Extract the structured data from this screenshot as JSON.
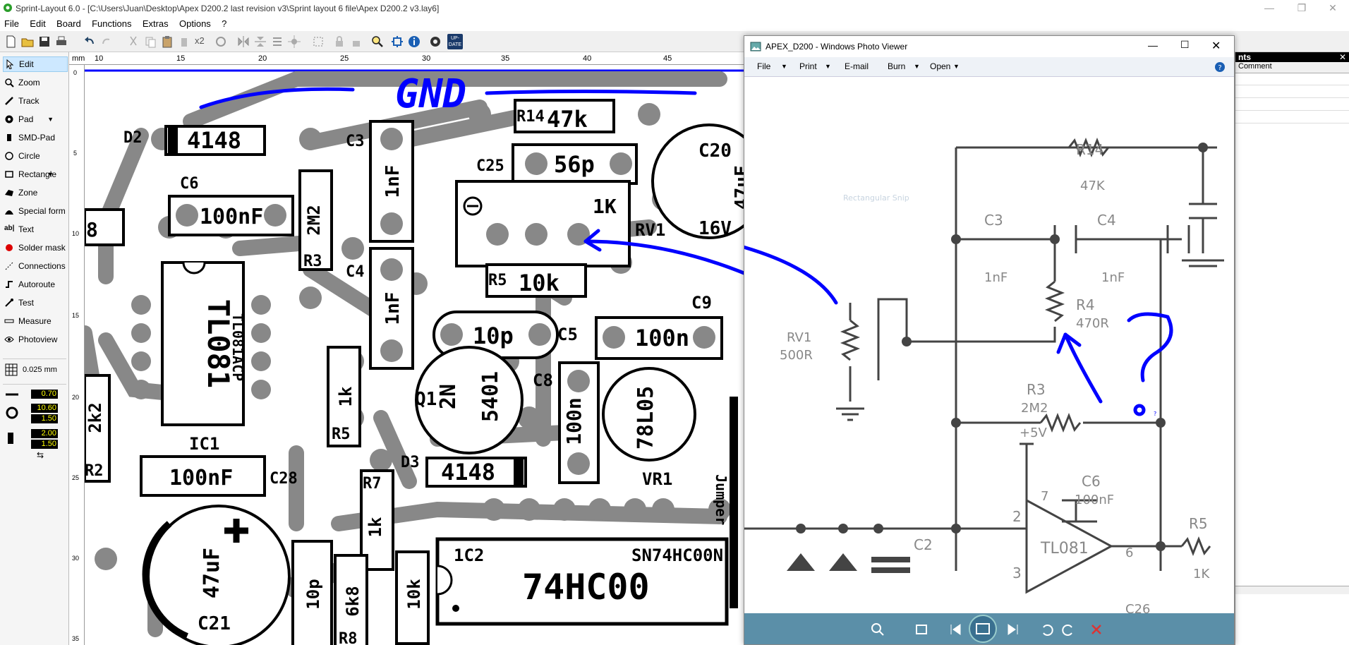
{
  "app": {
    "title": "Sprint-Layout 6.0 - [C:\\Users\\Juan\\Desktop\\Apex D200.2 last revision v3\\Sprint layout 6 file\\Apex D200.2 v3.lay6]",
    "accent": "#0000ff"
  },
  "menu": [
    "File",
    "Edit",
    "Board",
    "Functions",
    "Extras",
    "Options",
    "?"
  ],
  "toolbar": {
    "mult": "x2",
    "update": "UP-DATE"
  },
  "sidebar": {
    "tools": [
      {
        "label": "Edit",
        "icon": "cursor-icon"
      },
      {
        "label": "Zoom",
        "icon": "zoom-icon"
      },
      {
        "label": "Track",
        "icon": "track-icon"
      },
      {
        "label": "Pad",
        "icon": "pad-icon"
      },
      {
        "label": "SMD-Pad",
        "icon": "smd-pad-icon"
      },
      {
        "label": "Circle",
        "icon": "circle-icon"
      },
      {
        "label": "Rectangle",
        "icon": "rectangle-icon"
      },
      {
        "label": "Zone",
        "icon": "zone-icon"
      },
      {
        "label": "Special form",
        "icon": "special-form-icon"
      },
      {
        "label": "Text",
        "icon": "text-icon"
      },
      {
        "label": "Solder mask",
        "icon": "solder-mask-icon"
      },
      {
        "label": "Connections",
        "icon": "connections-icon"
      },
      {
        "label": "Autoroute",
        "icon": "autoroute-icon"
      },
      {
        "label": "Test",
        "icon": "test-icon"
      },
      {
        "label": "Measure",
        "icon": "measure-icon"
      },
      {
        "label": "Photoview",
        "icon": "photoview-icon"
      }
    ],
    "grid": "0.025 mm",
    "track_width": "0.70",
    "pad_outer": "10.60",
    "pad_inner": "1.50",
    "smd_w": "2.00",
    "smd_h": "1.50"
  },
  "ruler": {
    "unit": "mm",
    "top_ticks": [
      "10",
      "15",
      "20",
      "25",
      "30",
      "35",
      "40",
      "45"
    ],
    "left_ticks": [
      "0",
      "5",
      "10",
      "15",
      "20",
      "25",
      "30",
      "35"
    ]
  },
  "pcb": {
    "gnd": "GND",
    "labels": {
      "d2": "D2",
      "d2v": "4148",
      "c3": "C3",
      "c3v": "1nF",
      "r14": "R14",
      "r14v": "47k",
      "c20": "C20",
      "c20v": "47uF",
      "c20v2": "16V",
      "c25": "C25",
      "c25v": "56p",
      "c6": "C6",
      "c6v": "100nF",
      "r3v": "2M2",
      "r3": "R3",
      "rv1v": "1K",
      "rv1": "RV1",
      "c4": "C4",
      "c4v": "1nF",
      "r5": "R5",
      "r5v": "10k",
      "ic1v": "TL081",
      "ic1p": "TL081ACP",
      "ic1": "IC1",
      "c5v": "10p",
      "c5": "C5",
      "c9": "C9",
      "c9v": "100n",
      "q1": "Q1",
      "q1v": "2N",
      "q1v2": "5401",
      "c8": "C8",
      "c8v": "100n",
      "vr1v": "78L05",
      "vr1": "VR1",
      "r5b": "R5",
      "r5bv": "1k",
      "d3": "D3",
      "d3v": "4148",
      "c28v": "100nF",
      "c28": "C28",
      "r7": "R7",
      "r7v": "1k",
      "jumper": "Jumper",
      "ic2": "1C2",
      "ic2p": "SN74HC00N",
      "ic2v": "74HC00",
      "c21v": "47uF",
      "c21": "C21",
      "r2": "R2",
      "r2v": "2k2",
      "a8": "8",
      "b10p": "10p",
      "b6k8": "6k8",
      "r8": "R8",
      "b10k": "10k"
    }
  },
  "photo_viewer": {
    "title": "APEX_D200 - Windows Photo Viewer",
    "menu": [
      "File",
      "Print",
      "E-mail",
      "Burn",
      "Open"
    ],
    "schem": {
      "r14": "R14",
      "r14v": "47K",
      "c3": "C3",
      "c3v": "1nF",
      "c4": "C4",
      "c4v": "1nF",
      "r4": "R4",
      "r4v": "470R",
      "rv1": "RV1",
      "rv1v": "500R",
      "r3": "R3",
      "r3v": "2M2",
      "plus5": "+5V",
      "c6": "C6",
      "c6v": "100nF",
      "pin2": "2",
      "pin3": "3",
      "pin6": "6",
      "pin7": "7",
      "tl": "TL081",
      "c2": "C2",
      "r5": "R5",
      "r5v": "1K",
      "q": "?",
      "c26": "C26",
      "hidden": "Rectangular Snip"
    }
  },
  "right_panel": {
    "header": "nts",
    "col": "Comment"
  }
}
